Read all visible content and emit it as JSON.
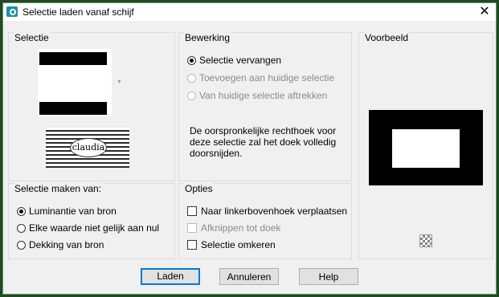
{
  "window": {
    "title": "Selectie laden vanaf schijf",
    "close_glyph": "✕"
  },
  "selectie": {
    "label": "Selectie",
    "logo_text": "claudia"
  },
  "bewerking": {
    "label": "Bewerking",
    "options": [
      {
        "label": "Selectie vervangen",
        "checked": true,
        "disabled": false
      },
      {
        "label": "Toevoegen aan huidige selectie",
        "checked": false,
        "disabled": true
      },
      {
        "label": "Van huidige selectie aftrekken",
        "checked": false,
        "disabled": true
      }
    ],
    "description": "De oorspronkelijke rechthoek voor deze selectie zal het doek volledig doorsnijden."
  },
  "voorbeeld": {
    "label": "Voorbeeld"
  },
  "selectie_maken": {
    "label": "Selectie maken van:",
    "options": [
      {
        "label": "Luminantie van bron",
        "checked": true
      },
      {
        "label": "Elke waarde niet gelijk aan nul",
        "checked": false
      },
      {
        "label": "Dekking van bron",
        "checked": false
      }
    ]
  },
  "opties": {
    "label": "Opties",
    "options": [
      {
        "label": "Naar linkerbovenhoek verplaatsen",
        "checked": false,
        "disabled": false
      },
      {
        "label": "Afknippen tot doek",
        "checked": false,
        "disabled": true
      },
      {
        "label": "Selectie omkeren",
        "checked": false,
        "disabled": false
      }
    ]
  },
  "buttons": {
    "load": "Laden",
    "cancel": "Annuleren",
    "help": "Help"
  },
  "colors": {
    "frame": "#1f4a22",
    "default_button_border": "#0078d7",
    "dialog_bg": "#f0f0f0"
  }
}
